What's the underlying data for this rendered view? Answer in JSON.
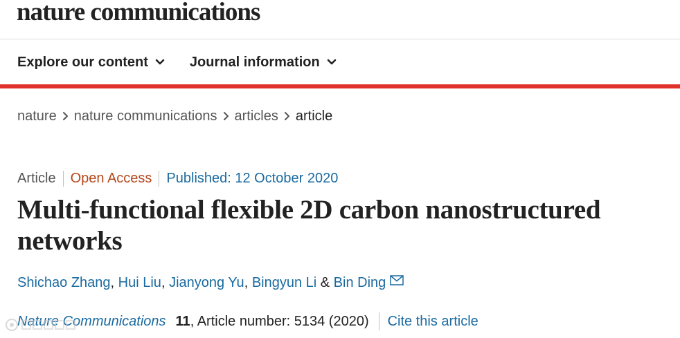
{
  "brand": {
    "name": "nature communications"
  },
  "nav": {
    "explore_label": "Explore our content",
    "journal_label": "Journal information"
  },
  "breadcrumb": {
    "items": [
      "nature",
      "nature communications",
      "articles",
      "article"
    ]
  },
  "article": {
    "type": "Article",
    "access": "Open Access",
    "published": "Published: 12 October 2020",
    "title": "Multi-functional flexible 2D carbon nanostructured networks",
    "authors": [
      "Shichao Zhang",
      "Hui Liu",
      "Jianyong Yu",
      "Bingyun Li",
      "Bin Ding"
    ],
    "author_sep": ", ",
    "author_and": " & ",
    "journal": "Nature Communications",
    "volume": "11",
    "article_number": ", Article number: 5134 (2020)",
    "cite_label": "Cite this article"
  },
  "colors": {
    "accent_red": "#e0312b",
    "link_blue": "#1a6aa0",
    "open_access": "#b5471b"
  }
}
